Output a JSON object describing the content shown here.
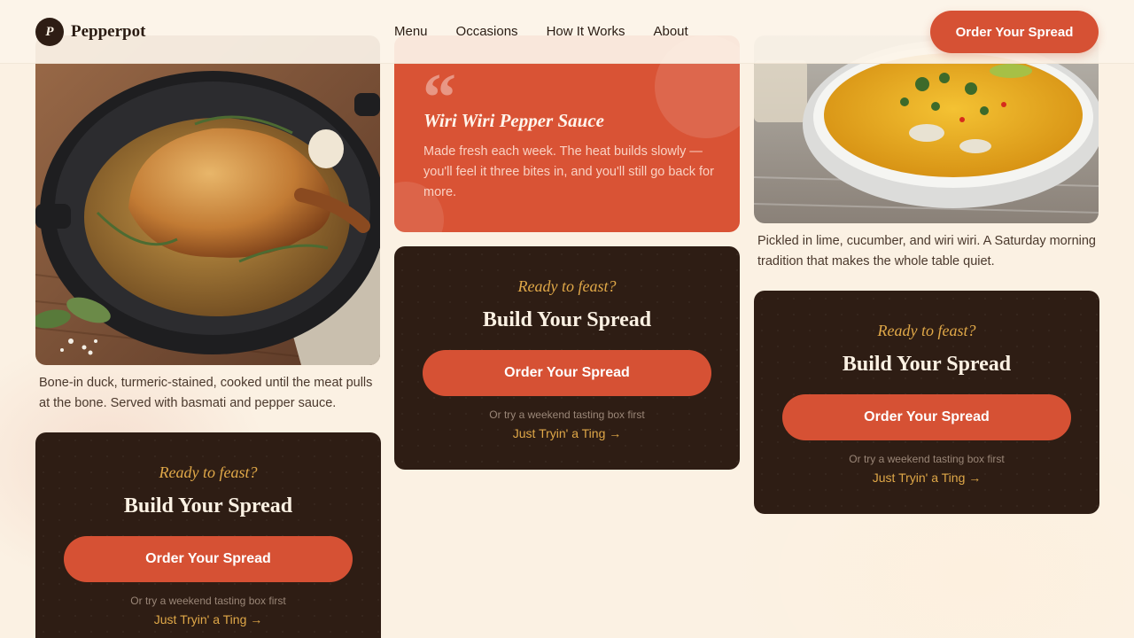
{
  "header": {
    "logo_mark": "P",
    "brand": "Pepperpot",
    "nav": [
      "Menu",
      "Occasions",
      "How It Works",
      "About"
    ],
    "cta_label": "Order Your Spread"
  },
  "col1": {
    "caption": "Bone-in duck, turmeric-stained, cooked until the meat pulls at the bone. Served with basmati and pepper sauce."
  },
  "quote": {
    "mark": "“",
    "title": "Wiri Wiri Pepper Sauce",
    "body": "Made fresh each week. The heat builds slowly — you'll feel it three bites in, and you'll still go back for more."
  },
  "col3": {
    "caption": "Pickled in lime, cucumber, and wiri wiri. A Saturday morning tradition that makes the whole table quiet."
  },
  "cta": {
    "eyebrow": "Ready to feast?",
    "title": "Build Your Spread",
    "button": "Order Your Spread",
    "sub": "Or try a weekend tasting box first",
    "link": "Just Tryin' a Ting →"
  },
  "colors": {
    "accent": "#d65134",
    "dark_card": "#2e1d14",
    "gold": "#e0a848",
    "background": "#fbf1e3"
  }
}
